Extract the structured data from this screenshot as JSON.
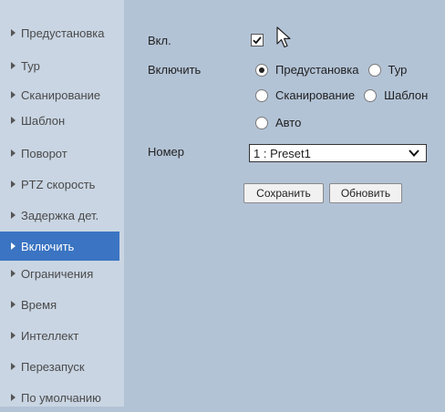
{
  "sidebar": {
    "items": [
      {
        "label": "Предустановка",
        "active": false
      },
      {
        "label": "Тур",
        "active": false
      },
      {
        "label": "Сканирование",
        "active": false
      },
      {
        "label": "Шаблон",
        "active": false
      },
      {
        "label": "Поворот",
        "active": false
      },
      {
        "label": "PTZ скорость",
        "active": false
      },
      {
        "label": "Задержка дет.",
        "active": false
      },
      {
        "label": "Включить",
        "active": true
      },
      {
        "label": "Ограничения",
        "active": false
      },
      {
        "label": "Время",
        "active": false
      },
      {
        "label": "Интеллект",
        "active": false
      },
      {
        "label": "Перезапуск",
        "active": false
      },
      {
        "label": "По умолчанию",
        "active": false
      }
    ]
  },
  "form": {
    "enable_label": "Вкл.",
    "enable_checked": true,
    "mode_label": "Включить",
    "modes": [
      {
        "label": "Предустановка",
        "selected": true
      },
      {
        "label": "Тур",
        "selected": false
      },
      {
        "label": "Сканирование",
        "selected": false
      },
      {
        "label": "Шаблон",
        "selected": false
      },
      {
        "label": "Авто",
        "selected": false
      }
    ],
    "number_label": "Номер",
    "number_value": "1 : Preset1",
    "save_label": "Сохранить",
    "refresh_label": "Обновить"
  },
  "colors": {
    "background": "#b3c3d6",
    "sidebar": "#c9d5e3",
    "active_item": "#3a74c2"
  }
}
